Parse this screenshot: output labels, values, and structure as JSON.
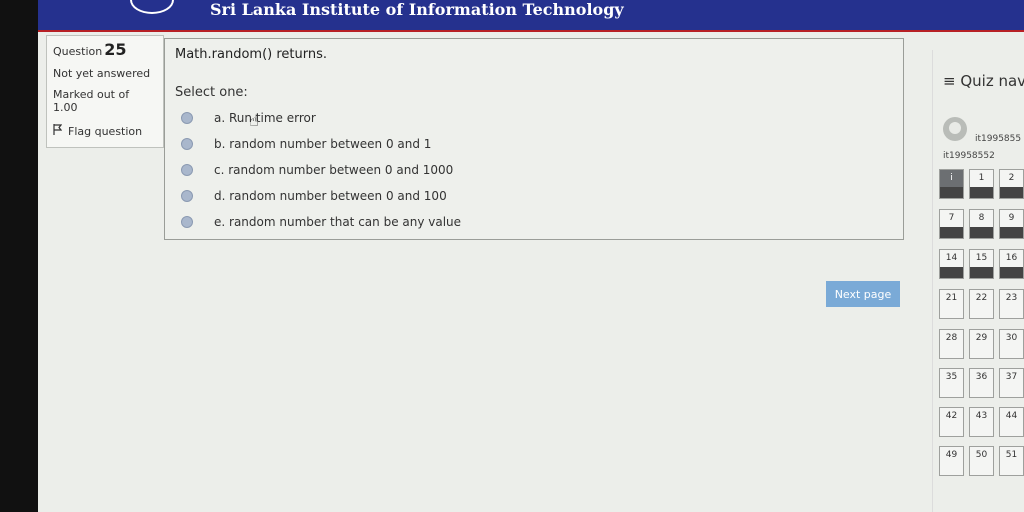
{
  "header": {
    "institute": "Sri Lanka Institute of Information Technology"
  },
  "question": {
    "label": "Question",
    "number": "25",
    "status": "Not yet answered",
    "marked_out_of": "Marked out of",
    "marks": "1.00",
    "flag_label": "Flag question",
    "text": "Math.random() returns.",
    "select_one": "Select one:",
    "options": [
      "a. Run time error",
      "b. random number between 0 and 1",
      "c. random number between 0 and 1000",
      "d. random number between 0 and 100",
      "e. random number that can be any value"
    ]
  },
  "next_label": "Next page",
  "nav": {
    "title": "≡ Quiz nav",
    "user_id_1": "it1995855",
    "user_id_2": "it19958552",
    "cells": [
      "i",
      "1",
      "2",
      "7",
      "8",
      "9",
      "14",
      "15",
      "16",
      "21",
      "22",
      "23",
      "28",
      "29",
      "30",
      "35",
      "36",
      "37",
      "42",
      "43",
      "44",
      "49",
      "50",
      "51"
    ]
  },
  "colors": {
    "banner": "#25318e",
    "accent_line": "#b72025",
    "button": "#7aaad7"
  }
}
